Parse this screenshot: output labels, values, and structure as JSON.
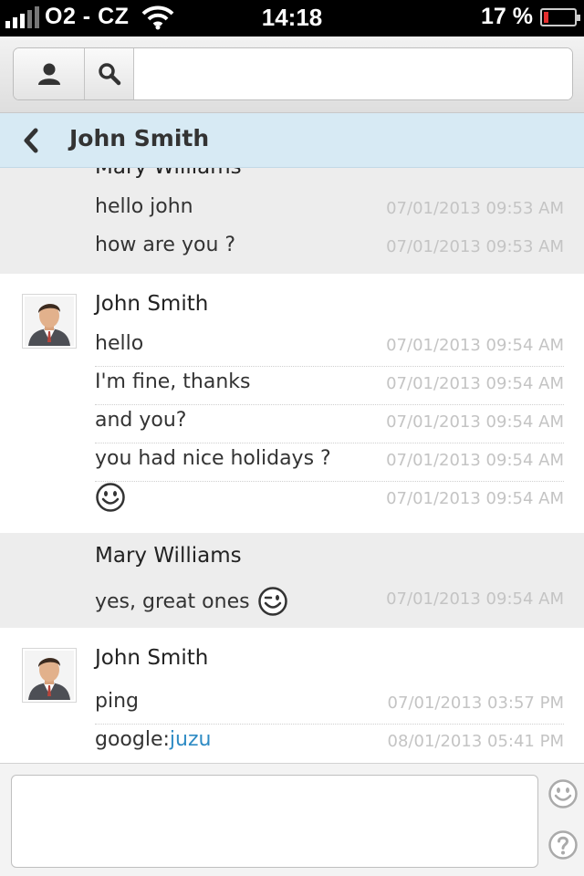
{
  "status_bar": {
    "carrier": "O2 - CZ",
    "time": "14:18",
    "battery_percent": "17 %",
    "battery_level": 0.17,
    "signal_bars": 3,
    "icons": [
      "signal-icon",
      "wifi-icon",
      "battery-icon"
    ]
  },
  "toolbar": {
    "icons": [
      "person-icon",
      "search-icon"
    ],
    "search_value": "",
    "search_placeholder": ""
  },
  "header": {
    "icon": "chevron-left-icon",
    "title": "John Smith"
  },
  "conversation": [
    {
      "sender": "Mary Williams",
      "side": "other",
      "messages": [
        {
          "text": "hello john",
          "time": "07/01/2013 09:53 AM"
        },
        {
          "text": "how are you ?",
          "time": "07/01/2013 09:53 AM"
        }
      ]
    },
    {
      "sender": "John Smith",
      "side": "self",
      "messages": [
        {
          "text": "hello",
          "time": "07/01/2013 09:54 AM"
        },
        {
          "text": "I'm fine, thanks",
          "time": "07/01/2013 09:54 AM"
        },
        {
          "text": "and you?",
          "time": "07/01/2013 09:54 AM"
        },
        {
          "text": "you had nice holidays ?",
          "time": "07/01/2013 09:54 AM"
        },
        {
          "text": "",
          "icon": "smiley-icon",
          "time": "07/01/2013 09:54 AM"
        }
      ]
    },
    {
      "sender": "Mary Williams",
      "side": "other",
      "messages": [
        {
          "text": "yes, great ones",
          "icon": "wink-icon",
          "time": "07/01/2013 09:54 AM"
        }
      ]
    },
    {
      "sender": "John Smith",
      "side": "self",
      "messages": [
        {
          "text": "ping",
          "time": "07/01/2013 03:57 PM"
        },
        {
          "text": "google:",
          "link": "juzu",
          "time": "08/01/2013 05:41 PM"
        }
      ]
    }
  ],
  "composer": {
    "value": "",
    "icons": [
      "emoticon-icon",
      "help-icon"
    ]
  },
  "colors": {
    "header_bg": "#d7eaf4",
    "other_block_bg": "#ededed",
    "link": "#2e8bc4",
    "timestamp": "#c4c4c4",
    "battery_low": "#e53030"
  }
}
